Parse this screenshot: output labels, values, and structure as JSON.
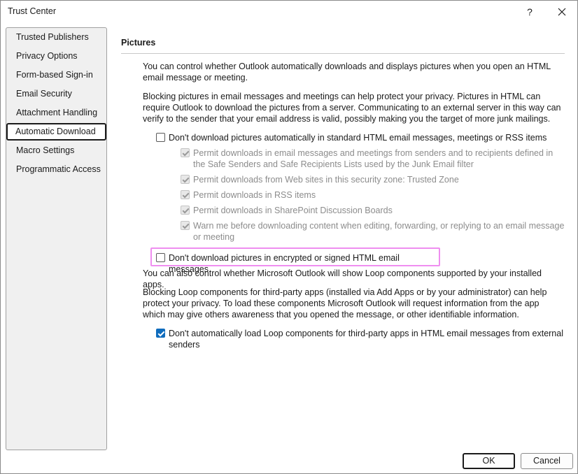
{
  "window": {
    "title": "Trust Center",
    "help_label": "?"
  },
  "sidebar": {
    "items": [
      {
        "label": "Trusted Publishers"
      },
      {
        "label": "Privacy Options"
      },
      {
        "label": "Form-based Sign-in"
      },
      {
        "label": "Email Security"
      },
      {
        "label": "Attachment Handling"
      },
      {
        "label": "Automatic Download",
        "selected": true
      },
      {
        "label": "Macro Settings"
      },
      {
        "label": "Programmatic Access"
      }
    ]
  },
  "main": {
    "section_title": "Pictures",
    "intro": "You can control whether Outlook automatically downloads and displays pictures when you open an HTML email message or meeting.",
    "blocking_note": "Blocking pictures in email messages and meetings can help protect your privacy. Pictures in HTML can require Outlook to download the pictures from a server. Communicating to an external server in this way can verify to the sender that your email address is valid, possibly making you the target of more junk mailings.",
    "dont_download_standard": {
      "label": "Don't download pictures automatically in standard HTML email messages, meetings or RSS items",
      "checked": false
    },
    "sub_options": [
      {
        "label": "Permit downloads in email messages and meetings from senders and to recipients defined in the Safe Senders and Safe Recipients Lists used by the Junk Email filter",
        "checked": true,
        "disabled": true
      },
      {
        "label": "Permit downloads from Web sites in this security zone: Trusted Zone",
        "checked": true,
        "disabled": true
      },
      {
        "label": "Permit downloads in RSS items",
        "checked": true,
        "disabled": true
      },
      {
        "label": "Permit downloads in SharePoint Discussion Boards",
        "checked": true,
        "disabled": true
      },
      {
        "label": "Warn me before downloading content when editing, forwarding, or replying to an email message or meeting",
        "checked": true,
        "disabled": true
      }
    ],
    "dont_download_encrypted": {
      "label": "Don't download pictures in encrypted or signed HTML email messages",
      "checked": false
    },
    "loop_intro": "You can also control whether Microsoft Outlook will show Loop components supported by your installed apps.",
    "loop_note": "Blocking Loop components for third-party apps (installed via Add Apps or by your administrator) can help protect your privacy. To load these components Microsoft Outlook will request information from the app which may give others awareness that you opened the message, or other identifiable information.",
    "dont_load_loop": {
      "label": "Don't automatically load Loop components for third-party apps in HTML email messages from external senders",
      "checked": true
    }
  },
  "footer": {
    "ok_label": "OK",
    "cancel_label": "Cancel"
  },
  "colors": {
    "accent": "#0f6cbd",
    "highlight": "#ef8ef0"
  }
}
